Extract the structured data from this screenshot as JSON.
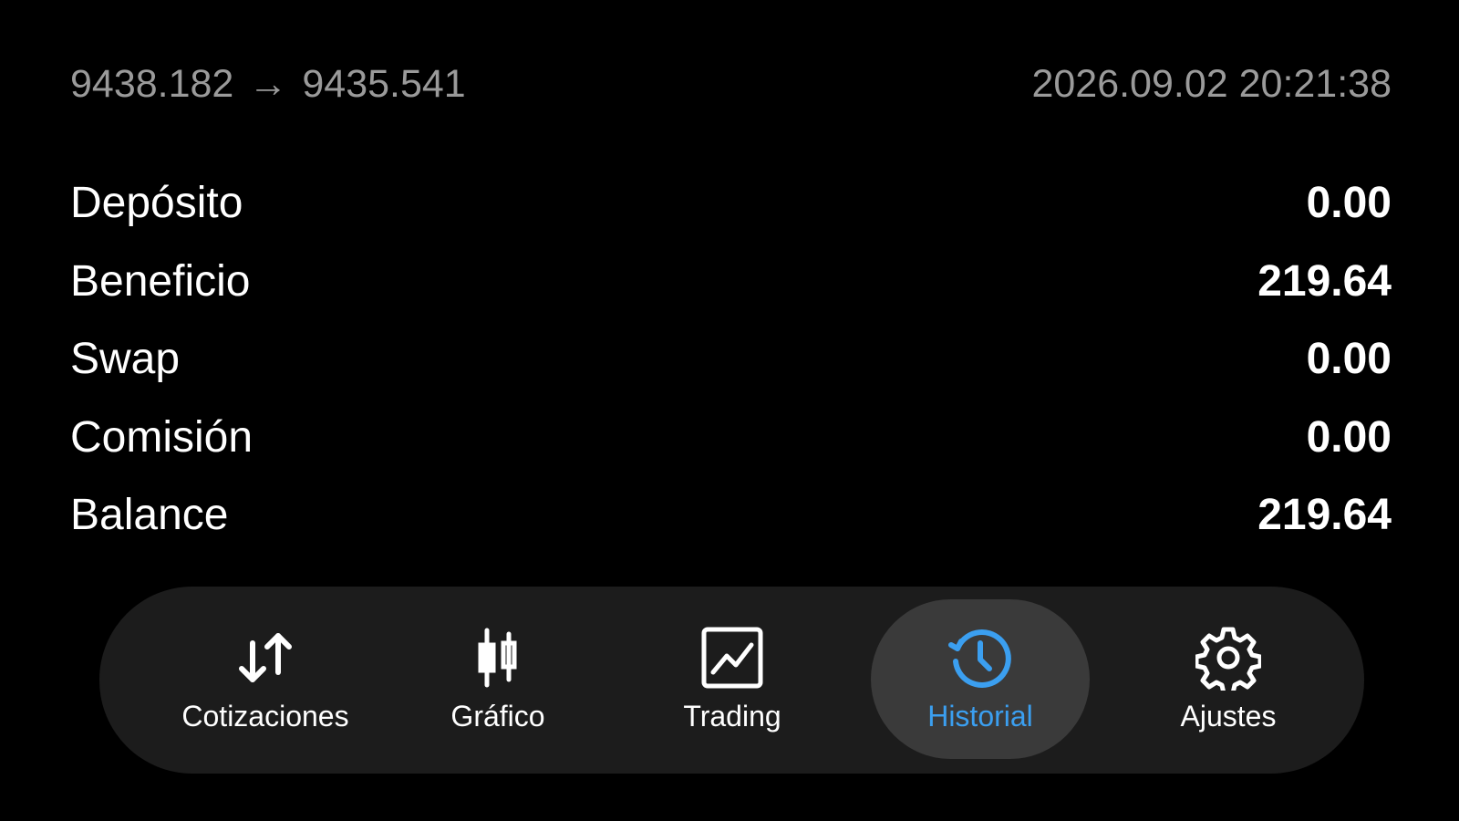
{
  "header": {
    "price_from": "9438.182",
    "arrow": "→",
    "price_to": "9435.541",
    "datetime": "2026.09.02 20:21:38"
  },
  "summary": [
    {
      "label": "Depósito",
      "value": "0.00"
    },
    {
      "label": "Beneficio",
      "value": "219.64"
    },
    {
      "label": "Swap",
      "value": "0.00"
    },
    {
      "label": "Comisión",
      "value": "0.00"
    },
    {
      "label": "Balance",
      "value": "219.64"
    }
  ],
  "nav": {
    "items": [
      {
        "label": "Cotizaciones",
        "icon": "quotes-arrows-icon",
        "active": false
      },
      {
        "label": "Gráfico",
        "icon": "candlestick-chart-icon",
        "active": false
      },
      {
        "label": "Trading",
        "icon": "trading-chart-icon",
        "active": false
      },
      {
        "label": "Historial",
        "icon": "history-clock-icon",
        "active": true
      },
      {
        "label": "Ajustes",
        "icon": "gear-icon",
        "active": false
      }
    ]
  },
  "colors": {
    "background": "#000000",
    "nav_background": "#1c1c1c",
    "active_pill": "#3a3a3a",
    "accent": "#3b9ff0",
    "secondary_text": "#9a9a9a",
    "primary_text": "#ffffff"
  }
}
